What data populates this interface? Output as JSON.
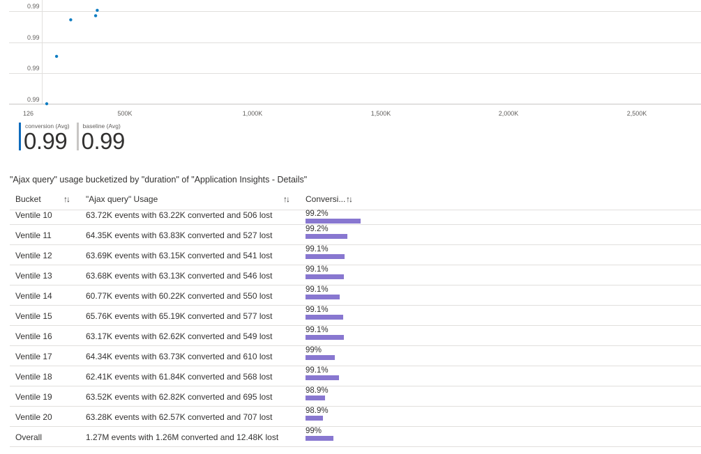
{
  "chart_data": {
    "type": "scatter",
    "y_tick_labels": [
      "0.99",
      "0.99",
      "0.99",
      "0.99"
    ],
    "x_tick_labels": [
      "126",
      "500K",
      "1,000K",
      "1,500K",
      "2,000K",
      "2,500K"
    ],
    "x_ticks": [
      126000,
      500000,
      1000000,
      1500000,
      2000000,
      2500000
    ],
    "xlim": [
      126000,
      2750000
    ],
    "ylim": [
      0.988,
      0.9952
    ],
    "series": [
      {
        "points": [
          {
            "x": 196000,
            "y": 0.988
          },
          {
            "x": 232000,
            "y": 0.9915
          },
          {
            "x": 284000,
            "y": 0.9942
          },
          {
            "x": 375000,
            "y": 0.9945
          },
          {
            "x": 381000,
            "y": 0.9949
          }
        ],
        "color": "#0f7dc2"
      }
    ],
    "grid": true
  },
  "legend": {
    "metrics": [
      {
        "label": "conversion (Avg)",
        "value": "0.99",
        "color": "#0f6cbd"
      },
      {
        "label": "baseline (Avg)",
        "value": "0.99",
        "color": "#c8c6c4"
      }
    ]
  },
  "table": {
    "title": "\"Ajax query\" usage bucketized by \"duration\" of \"Application Insights - Details\"",
    "headers": {
      "bucket": "Bucket",
      "usage": "\"Ajax query\" Usage",
      "conversion": "Conversi...",
      "sort_glyph": "↑↓"
    },
    "bar_color": "#8877d0",
    "rows": [
      {
        "bucket": "Ventile 10",
        "usage": "63.72K events with 63.22K converted and 506 lost",
        "pct": "99.2%",
        "fill": 0.992
      },
      {
        "bucket": "Ventile 11",
        "usage": "64.35K events with 63.83K converted and 527 lost",
        "pct": "99.2%",
        "fill": 0.99
      },
      {
        "bucket": "Ventile 12",
        "usage": "63.69K events with 63.15K converted and 541 lost",
        "pct": "99.1%",
        "fill": 0.9895
      },
      {
        "bucket": "Ventile 13",
        "usage": "63.68K events with 63.13K converted and 546 lost",
        "pct": "99.1%",
        "fill": 0.9894
      },
      {
        "bucket": "Ventile 14",
        "usage": "60.77K events with 60.22K converted and 550 lost",
        "pct": "99.1%",
        "fill": 0.9888
      },
      {
        "bucket": "Ventile 15",
        "usage": "65.76K events with 65.19K converted and 577 lost",
        "pct": "99.1%",
        "fill": 0.9893
      },
      {
        "bucket": "Ventile 16",
        "usage": "63.17K events with 62.62K converted and 549 lost",
        "pct": "99.1%",
        "fill": 0.9894
      },
      {
        "bucket": "Ventile 17",
        "usage": "64.34K events with 63.73K converted and 610 lost",
        "pct": "99%",
        "fill": 0.988
      },
      {
        "bucket": "Ventile 18",
        "usage": "62.41K events with 61.84K converted and 568 lost",
        "pct": "99.1%",
        "fill": 0.9887
      },
      {
        "bucket": "Ventile 19",
        "usage": "63.52K events with 62.82K converted and 695 lost",
        "pct": "98.9%",
        "fill": 0.9865
      },
      {
        "bucket": "Ventile 20",
        "usage": "63.28K events with 62.57K converted and 707 lost",
        "pct": "98.9%",
        "fill": 0.9862
      },
      {
        "bucket": "Overall",
        "usage": "1.27M events with 1.26M converted and 12.48K lost",
        "pct": "99%",
        "fill": 0.9878
      }
    ]
  }
}
